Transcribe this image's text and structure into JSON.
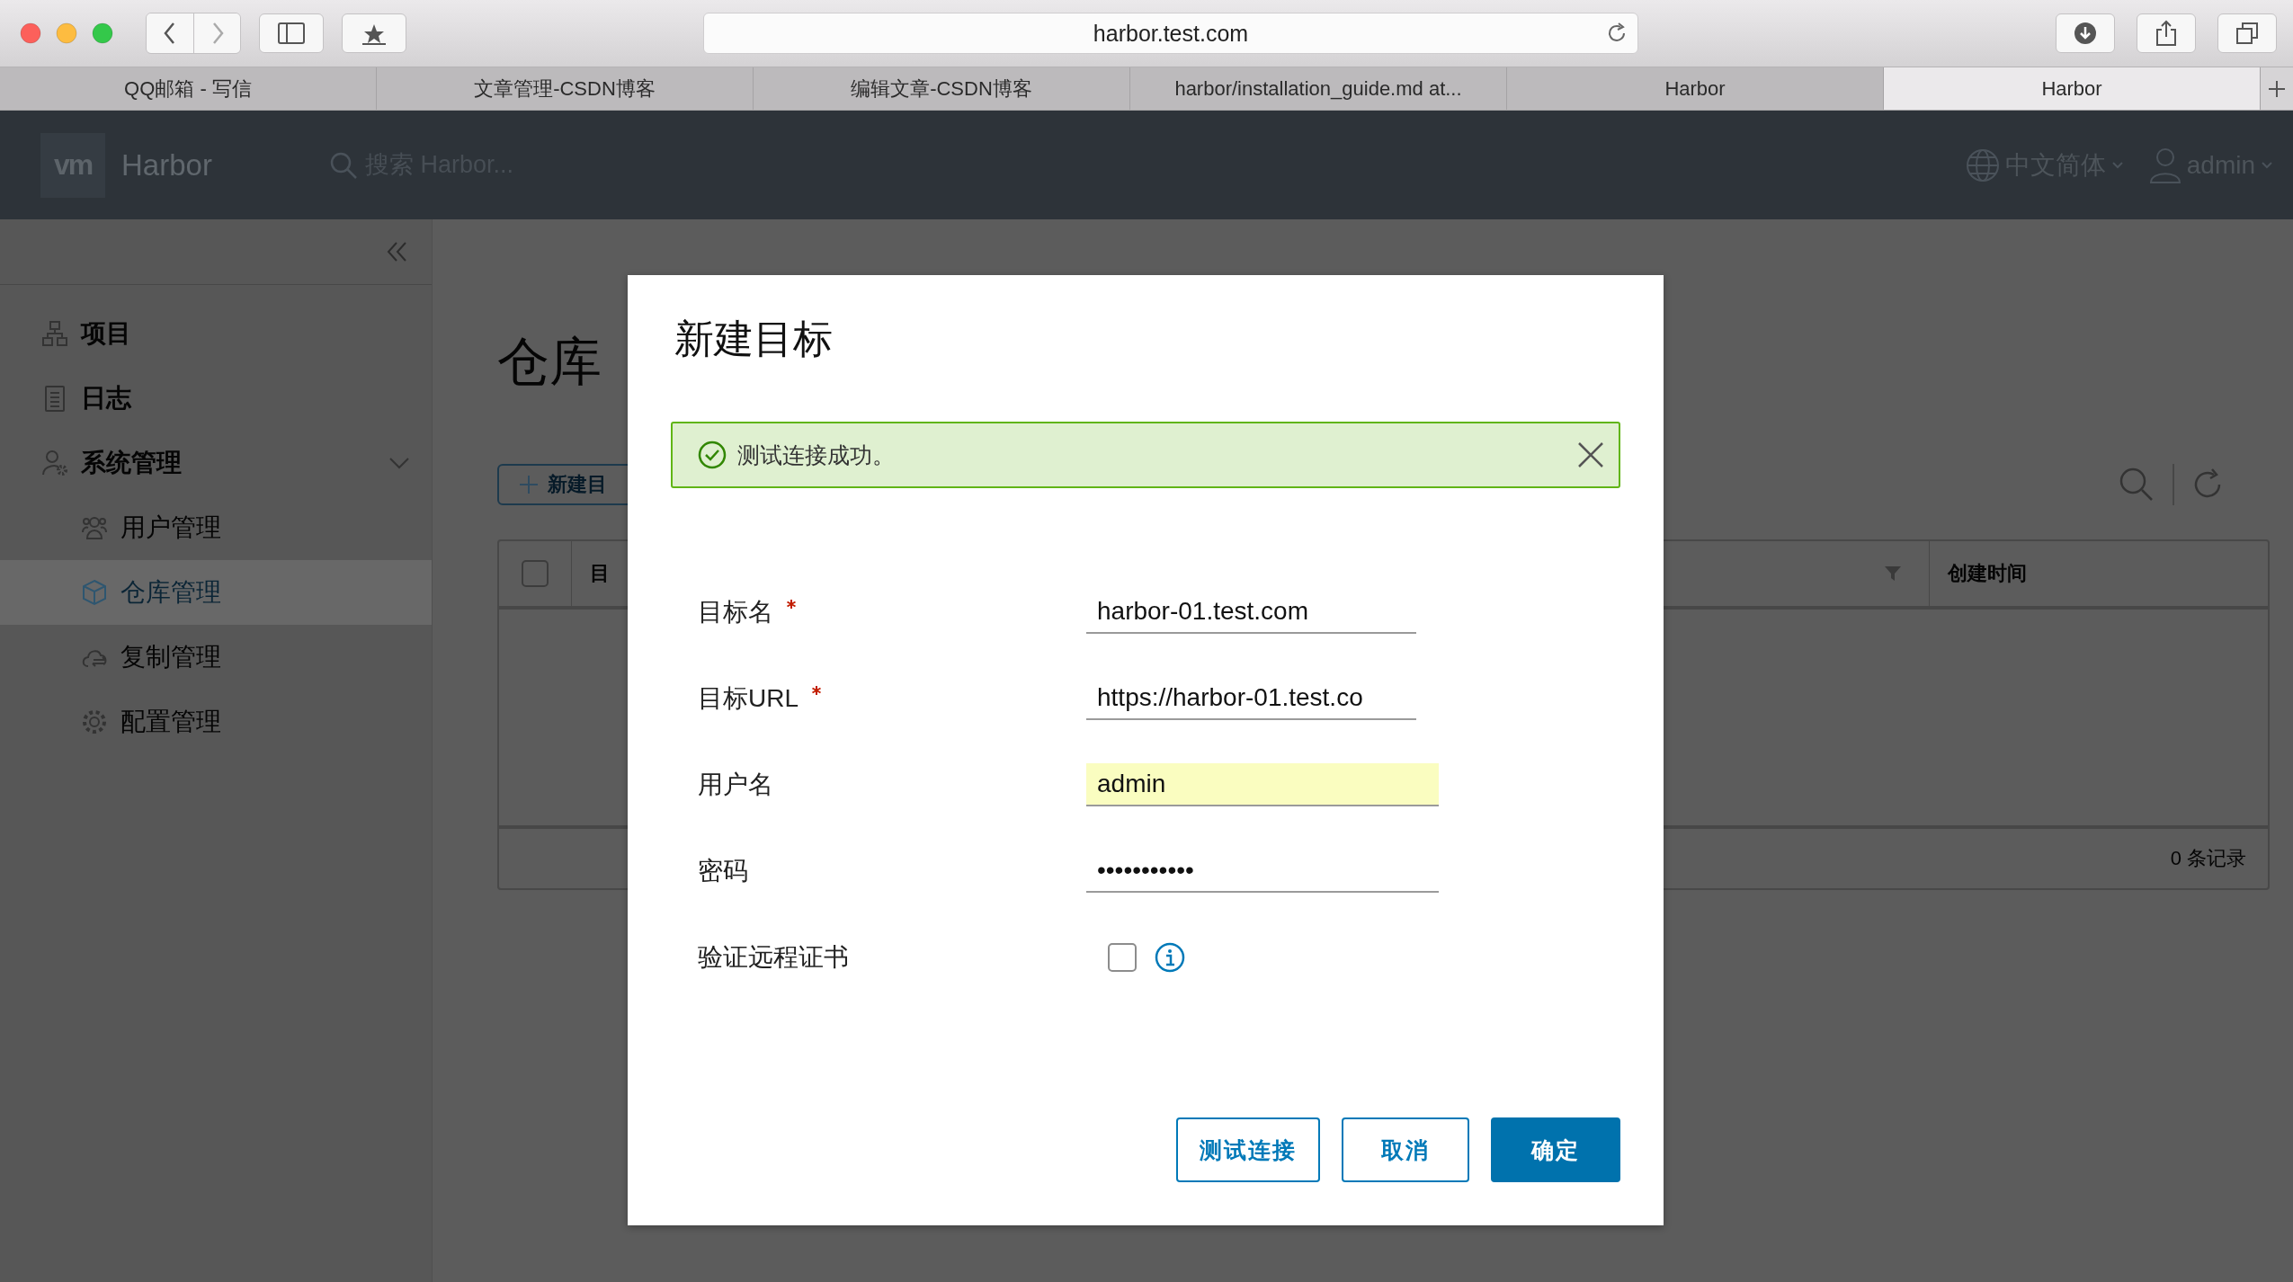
{
  "browser": {
    "address": "harbor.test.com",
    "tabs": [
      {
        "label": "QQ邮箱 - 写信",
        "selected": false
      },
      {
        "label": "文章管理-CSDN博客",
        "selected": false
      },
      {
        "label": "编辑文章-CSDN博客",
        "selected": false
      },
      {
        "label": "harbor/installation_guide.md at...",
        "selected": false
      },
      {
        "label": "Harbor",
        "selected": false
      },
      {
        "label": "Harbor",
        "selected": true
      }
    ]
  },
  "app_header": {
    "logo": "vm",
    "brand": "Harbor",
    "search": {
      "placeholder": "搜索 Harbor..."
    },
    "language": "中文简体",
    "user": "admin"
  },
  "sidebar": {
    "items": [
      {
        "label": "项目",
        "selected": false
      },
      {
        "label": "日志",
        "selected": false
      },
      {
        "label": "系统管理",
        "selected": false,
        "expanded": true,
        "children": [
          {
            "label": "用户管理",
            "selected": false
          },
          {
            "label": "仓库管理",
            "selected": true
          },
          {
            "label": "复制管理",
            "selected": false
          },
          {
            "label": "配置管理",
            "selected": false
          }
        ]
      }
    ]
  },
  "page": {
    "title": "仓库",
    "new_button": "新建目",
    "table": {
      "select_all": {
        "checked": false
      },
      "columns": [
        "目",
        "创建时间"
      ],
      "footer": "0 条记录"
    }
  },
  "dialog": {
    "title": "新建目标",
    "alert": {
      "kind": "success",
      "message": "测试连接成功。"
    },
    "fields": [
      {
        "label": "目标名",
        "required": true,
        "kind": "text",
        "value": "harbor-01.test.com",
        "autofilled": false
      },
      {
        "label": "目标URL",
        "required": true,
        "kind": "text",
        "value": "https://harbor-01.test.co",
        "autofilled": false
      },
      {
        "label": "用户名",
        "required": false,
        "kind": "text",
        "value": "admin",
        "autofilled": true
      },
      {
        "label": "密码",
        "required": false,
        "kind": "text",
        "value": "•••••••••••",
        "autofilled": false
      },
      {
        "label": "验证远程证书",
        "required": false,
        "kind": "checkbox",
        "checked": false
      }
    ],
    "buttons": [
      {
        "label": "测试连接",
        "primary": false
      },
      {
        "label": "取消",
        "primary": false
      },
      {
        "label": "确定",
        "primary": true
      }
    ]
  }
}
